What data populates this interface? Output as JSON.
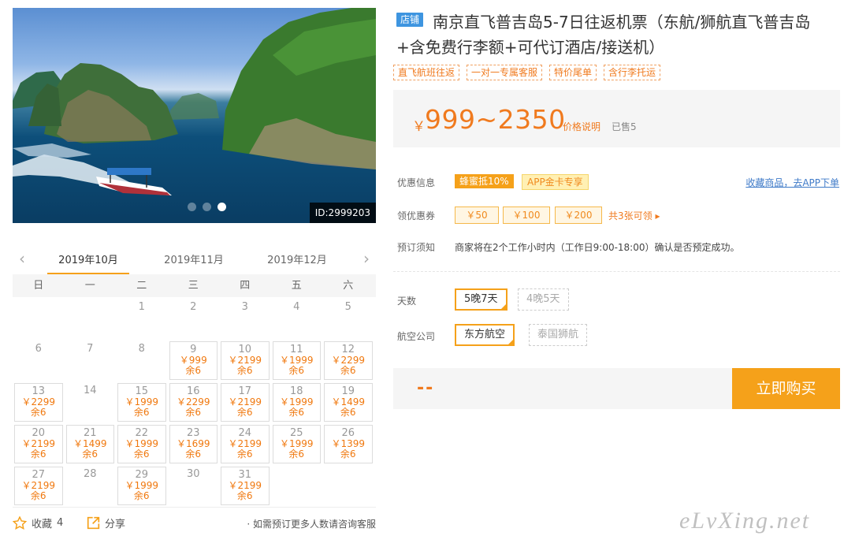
{
  "photo": {
    "id_badge": "ID:2999203",
    "slides": 3,
    "active_slide": 3
  },
  "calendar": {
    "prev_icon": "chevron-left-icon",
    "next_icon": "chevron-right-icon",
    "tabs": [
      "2019年10月",
      "2019年11月",
      "2019年12月"
    ],
    "active_tab": 0,
    "weekdays": [
      "日",
      "一",
      "二",
      "三",
      "四",
      "五",
      "六"
    ],
    "days": [
      {
        "d": ""
      },
      {
        "d": ""
      },
      {
        "d": "1"
      },
      {
        "d": "2"
      },
      {
        "d": "3"
      },
      {
        "d": "4"
      },
      {
        "d": "5"
      },
      {
        "d": "6"
      },
      {
        "d": "7"
      },
      {
        "d": "8"
      },
      {
        "d": "9",
        "price": "￥999",
        "left": "余6"
      },
      {
        "d": "10",
        "price": "￥2199",
        "left": "余6"
      },
      {
        "d": "11",
        "price": "￥1999",
        "left": "余6"
      },
      {
        "d": "12",
        "price": "￥2299",
        "left": "余6"
      },
      {
        "d": "13",
        "price": "￥2299",
        "left": "余6"
      },
      {
        "d": "14"
      },
      {
        "d": "15",
        "price": "￥1999",
        "left": "余6"
      },
      {
        "d": "16",
        "price": "￥2299",
        "left": "余6"
      },
      {
        "d": "17",
        "price": "￥2199",
        "left": "余6"
      },
      {
        "d": "18",
        "price": "￥1999",
        "left": "余6"
      },
      {
        "d": "19",
        "price": "￥1499",
        "left": "余6"
      },
      {
        "d": "20",
        "price": "￥2199",
        "left": "余6"
      },
      {
        "d": "21",
        "price": "￥1499",
        "left": "余6"
      },
      {
        "d": "22",
        "price": "￥1999",
        "left": "余6"
      },
      {
        "d": "23",
        "price": "￥1699",
        "left": "余6"
      },
      {
        "d": "24",
        "price": "￥2199",
        "left": "余6"
      },
      {
        "d": "25",
        "price": "￥1999",
        "left": "余6"
      },
      {
        "d": "26",
        "price": "￥1399",
        "left": "余6"
      },
      {
        "d": "27",
        "price": "￥2199",
        "left": "余6"
      },
      {
        "d": "28"
      },
      {
        "d": "29",
        "price": "￥1999",
        "left": "余6"
      },
      {
        "d": "30"
      },
      {
        "d": "31",
        "price": "￥2199",
        "left": "余6"
      }
    ]
  },
  "bottom": {
    "fav_label": "收藏",
    "fav_count": "4",
    "share_label": "分享",
    "note": "· 如需预订更多人数请咨询客服"
  },
  "product": {
    "shop_tag": "店铺",
    "title": "南京直飞普吉岛5-7日往返机票（东航/狮航直飞普吉岛+含免费行李额+可代订酒店/接送机）",
    "tags": [
      "直飞航班往返",
      "一对一专属客服",
      "特价尾单",
      "含行李托运"
    ],
    "price_yen": "￥",
    "price": "999~2350",
    "price_explain": "价格说明",
    "sold": "已售5",
    "promo_label": "优惠信息",
    "promo_badges": [
      "蜂蜜抵10%",
      "APP金卡专享"
    ],
    "fav_app_link": "收藏商品，去APP下单",
    "coupon_label": "领优惠券",
    "coupons": [
      "￥50",
      "￥100",
      "￥200"
    ],
    "coupon_more": "共3张可领 ▸",
    "notice_label": "预订须知",
    "notice_text": "商家将在2个工作小时内（工作日9:00-18:00）确认是否预定成功。",
    "days_label": "天数",
    "days_options": [
      "5晚7天",
      "4晚5天"
    ],
    "airline_label": "航空公司",
    "airline_options": [
      "东方航空",
      "泰国狮航"
    ],
    "total_placeholder": "--",
    "buy_label": "立即购买"
  },
  "watermark": "eLvXing.net",
  "colors": {
    "accent": "#f5a11a",
    "price": "#f07a1e",
    "link": "#3e7ac8",
    "shop_tag": "#3e95e0"
  }
}
